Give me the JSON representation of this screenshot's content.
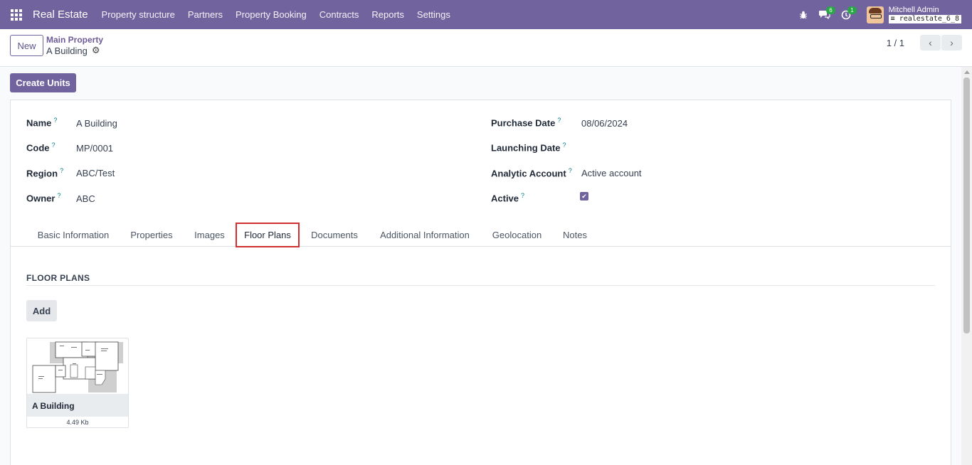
{
  "navbar": {
    "app_name": "Real Estate",
    "menu": [
      "Property structure",
      "Partners",
      "Property Booking",
      "Contracts",
      "Reports",
      "Settings"
    ],
    "messages_count": "6",
    "activity_count": "1",
    "user_name": "Mitchell Admin",
    "database": "realestate_6_8",
    "accent_color": "#71639e"
  },
  "control": {
    "new_label": "New",
    "breadcrumb_parent": "Main Property",
    "breadcrumb_current": "A Building",
    "pager": "1 / 1"
  },
  "actions": {
    "create_units": "Create Units"
  },
  "form": {
    "name_label": "Name",
    "name_value": "A Building",
    "code_label": "Code",
    "code_value": "MP/0001",
    "region_label": "Region",
    "region_value": "ABC/Test",
    "owner_label": "Owner",
    "owner_value": "ABC",
    "purchase_date_label": "Purchase Date",
    "purchase_date_value": "08/06/2024",
    "launching_date_label": "Launching Date",
    "launching_date_value": "",
    "analytic_account_label": "Analytic Account",
    "analytic_account_value": "Active account",
    "active_label": "Active",
    "active_checked": true,
    "help_marker": "?"
  },
  "tabs": [
    "Basic Information",
    "Properties",
    "Images",
    "Floor Plans",
    "Documents",
    "Additional Information",
    "Geolocation",
    "Notes"
  ],
  "active_tab": "Floor Plans",
  "floor_plans": {
    "section_title": "FLOOR PLANS",
    "add_label": "Add",
    "items": [
      {
        "title": "A Building",
        "size": "4.49 Kb"
      }
    ]
  }
}
